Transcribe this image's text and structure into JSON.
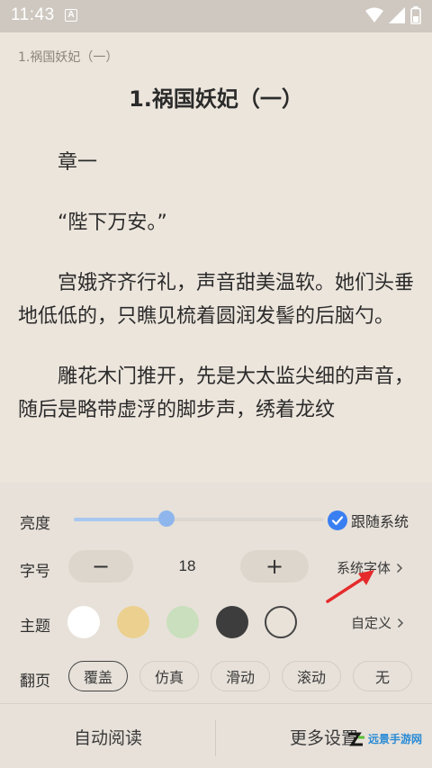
{
  "status_bar": {
    "time": "11:43",
    "notif_glyph": "A"
  },
  "reader": {
    "running_header": "1.祸国妖妃（一）",
    "chapter_title": "1.祸国妖妃（一）",
    "paragraphs": [
      "章一",
      "“陛下万安。”",
      "宫娥齐齐行礼，声音甜美温软。她们头垂地低低的，只瞧见梳着圆润发髻的后脑勺。",
      "雕花木门推开，先是大太监尖细的声音，随后是略带虚浮的脚步声，绣着龙纹"
    ]
  },
  "settings": {
    "brightness": {
      "label": "亮度",
      "level_fraction": 0.37,
      "follow_system_label": "跟随系统",
      "follow_system_checked": true
    },
    "font_size": {
      "label": "字号",
      "decrease": "−",
      "value": "18",
      "increase": "+",
      "system_font_label": "系统字体"
    },
    "theme": {
      "label": "主题",
      "swatches": [
        "#ffffff",
        "#ecd08f",
        "#c9dfbd",
        "#3d3d3d",
        "#e9e2d8"
      ],
      "selected_index": 4,
      "custom_label": "自定义"
    },
    "page_turn": {
      "label": "翻页",
      "options": [
        "覆盖",
        "仿真",
        "滑动",
        "滚动",
        "无"
      ],
      "selected_index": 0
    }
  },
  "bottom_bar": {
    "auto_read": "自动阅读",
    "more_settings": "更多设置"
  },
  "watermark": {
    "text": "远景手游网"
  },
  "colors": {
    "accent": "#3a7ff1",
    "slider": "#8fb6ec",
    "annotation": "#e52b2b",
    "background": "#ece5dc"
  }
}
